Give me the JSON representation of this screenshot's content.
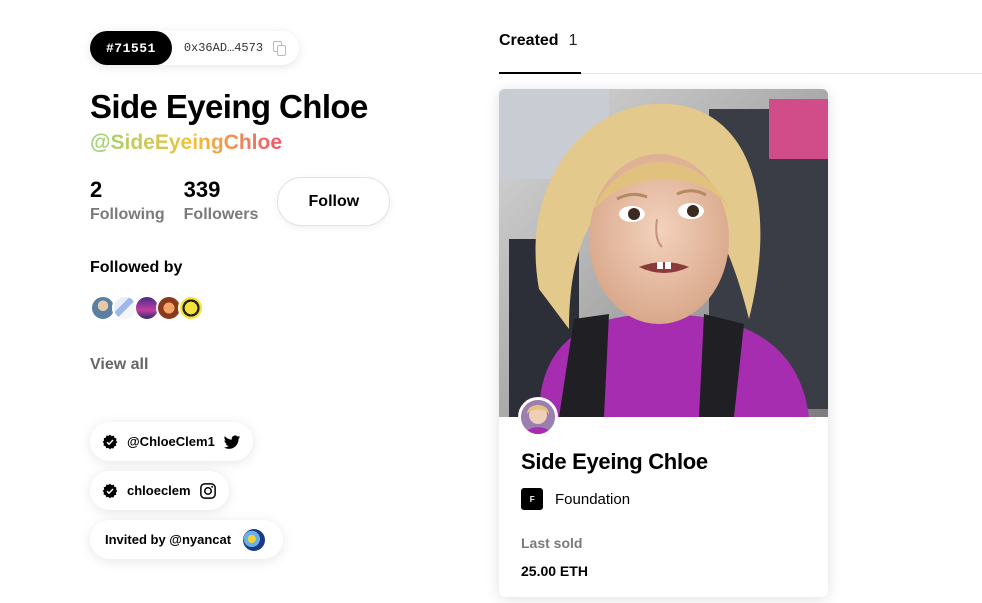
{
  "profile": {
    "token_id": "#71551",
    "address": "0x36AD…4573",
    "name": "Side Eyeing Chloe",
    "handle": "@SideEyeingChloe",
    "following_count": "2",
    "following_label": "Following",
    "followers_count": "339",
    "followers_label": "Followers",
    "follow_button": "Follow",
    "followed_by_label": "Followed by",
    "view_all": "View all"
  },
  "social": {
    "twitter_handle": "@ChloeClem1",
    "instagram_handle": "chloeclem",
    "invited_by": "Invited by @nyancat"
  },
  "tabs": [
    {
      "label": "Created",
      "count": "1"
    }
  ],
  "card": {
    "title": "Side Eyeing Chloe",
    "platform": "Foundation",
    "platform_icon_text": "F",
    "last_sold_label": "Last sold",
    "price": "25.00 ETH"
  },
  "icons": {
    "copy": "copy-icon",
    "verified": "verified-badge-icon",
    "twitter": "twitter-icon",
    "instagram": "instagram-icon"
  }
}
